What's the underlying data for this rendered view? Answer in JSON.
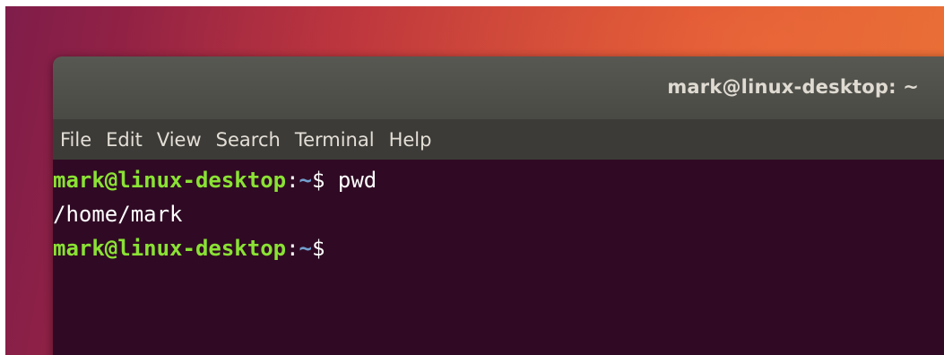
{
  "window": {
    "title": "mark@linux-desktop: ~"
  },
  "menu": {
    "items": [
      "File",
      "Edit",
      "View",
      "Search",
      "Terminal",
      "Help"
    ]
  },
  "terminal": {
    "lines": [
      {
        "user_host": "mark@linux-desktop",
        "colon": ":",
        "path": "~",
        "symbol": "$ ",
        "command": "pwd"
      },
      {
        "output": "/home/mark"
      },
      {
        "user_host": "mark@linux-desktop",
        "colon": ":",
        "path": "~",
        "symbol": "$",
        "command": ""
      }
    ]
  },
  "colors": {
    "terminal_bg": "#300a24",
    "prompt_user": "#8ae234",
    "prompt_path": "#729fcf",
    "titlebar": "#4f4f4a",
    "menubar": "#3c3b37"
  }
}
